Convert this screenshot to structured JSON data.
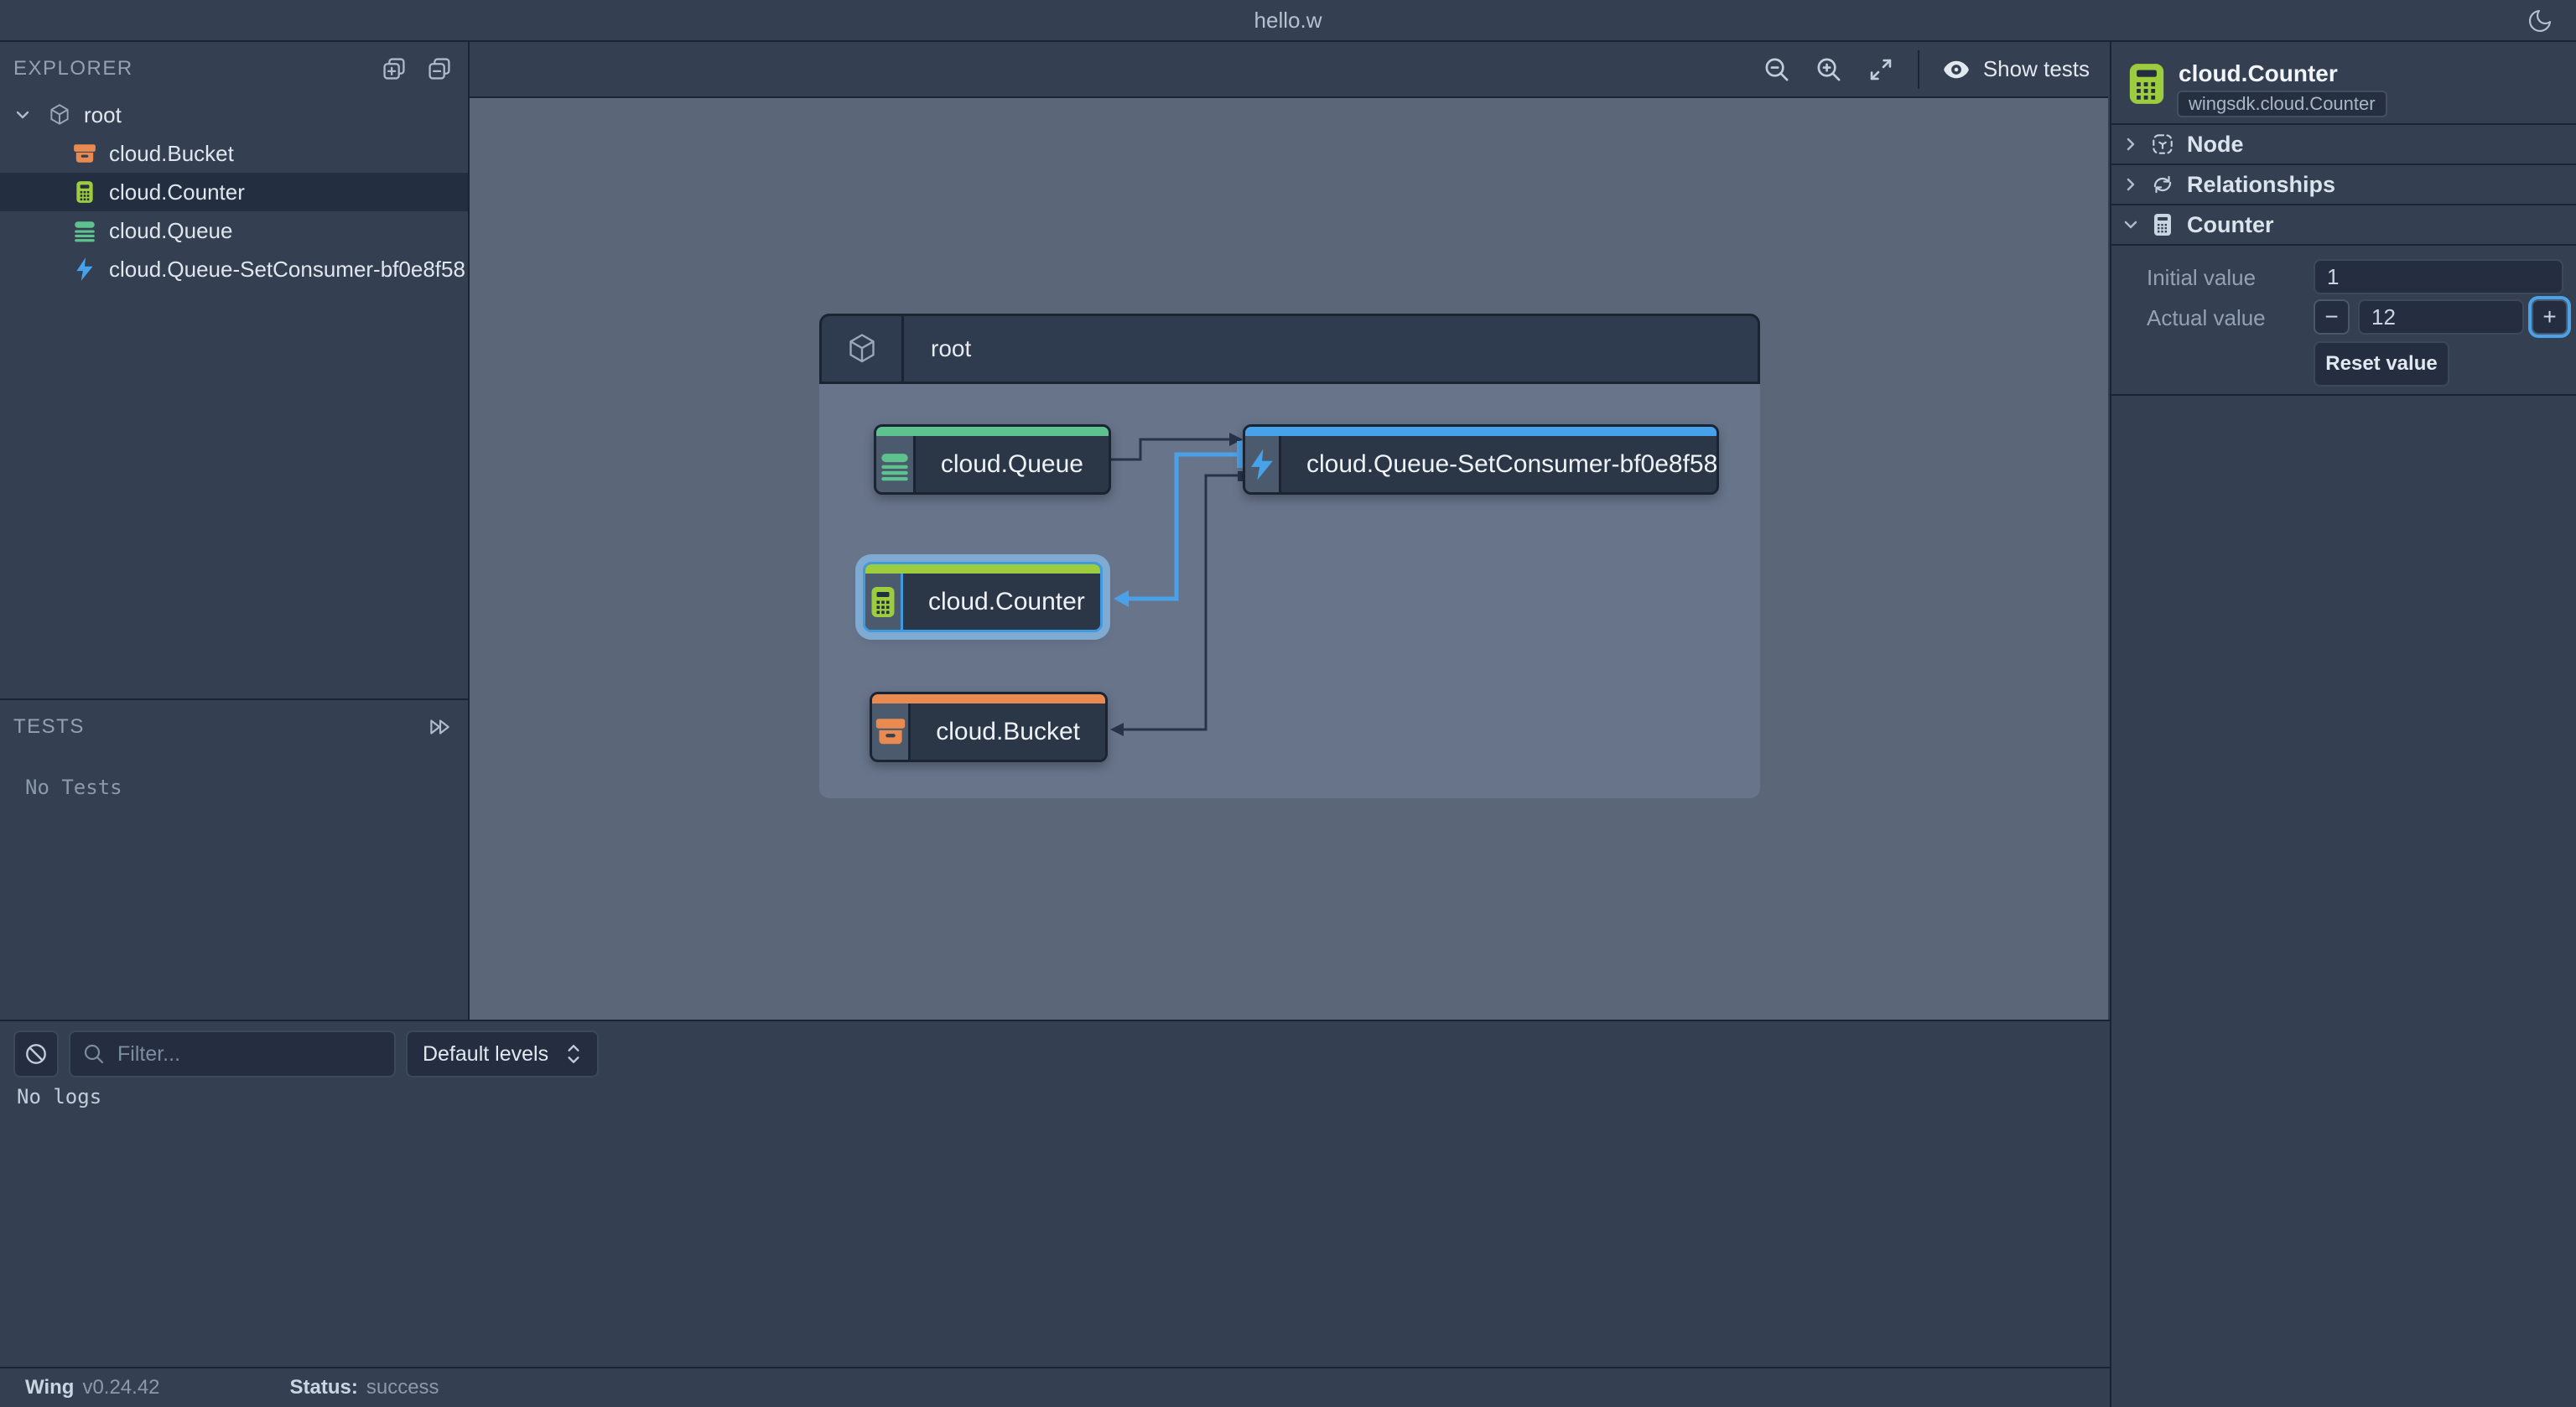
{
  "titlebar": {
    "title": "hello.w"
  },
  "explorer": {
    "title": "EXPLORER",
    "root": {
      "label": "root"
    },
    "items": [
      {
        "label": "cloud.Bucket",
        "icon": "bucket-icon",
        "color": "#e98a50",
        "selected": false
      },
      {
        "label": "cloud.Counter",
        "icon": "counter-icon",
        "color": "#9ecc3f",
        "selected": true
      },
      {
        "label": "cloud.Queue",
        "icon": "queue-icon",
        "color": "#5ec28f",
        "selected": false
      },
      {
        "label": "cloud.Queue-SetConsumer-bf0e8f58",
        "icon": "function-icon",
        "color": "#46a2e9",
        "selected": false
      }
    ]
  },
  "tests": {
    "title": "TESTS",
    "empty_message": "No Tests"
  },
  "canvas": {
    "toolbar": {
      "zoom_out_icon": "magnifier-minus",
      "zoom_in_icon": "magnifier-plus",
      "fit_icon": "arrows-expand",
      "show_tests_label": "Show tests"
    },
    "container": {
      "label": "root"
    },
    "nodes": [
      {
        "label": "cloud.Queue",
        "accent": "#5ec28f",
        "selected": false
      },
      {
        "label": "cloud.Queue-SetConsumer-bf0e8f58",
        "accent": "#46a2e9",
        "selected": false
      },
      {
        "label": "cloud.Counter",
        "accent": "#9ecc3f",
        "selected": true
      },
      {
        "label": "cloud.Bucket",
        "accent": "#e98a50",
        "selected": false
      }
    ],
    "edges": [
      {
        "from": "cloud.Queue",
        "to": "cloud.Queue-SetConsumer-bf0e8f58",
        "highlighted": false
      },
      {
        "from": "cloud.Queue-SetConsumer-bf0e8f58",
        "to": "cloud.Counter",
        "highlighted": true
      },
      {
        "from": "cloud.Queue-SetConsumer-bf0e8f58",
        "to": "cloud.Bucket",
        "highlighted": false
      }
    ]
  },
  "inspector": {
    "resource": {
      "name": "cloud.Counter",
      "type_badge": "wingsdk.cloud.Counter"
    },
    "sections": [
      {
        "label": "Node",
        "expanded": false
      },
      {
        "label": "Relationships",
        "expanded": false
      },
      {
        "label": "Counter",
        "expanded": true
      }
    ],
    "counter": {
      "initial_label": "Initial value",
      "initial_value": "1",
      "actual_label": "Actual value",
      "actual_value": "12",
      "decrement_label": "−",
      "increment_label": "+",
      "reset_label": "Reset value"
    }
  },
  "logs": {
    "filter_placeholder": "Filter...",
    "level_select": "Default levels",
    "empty_message": "No logs"
  },
  "statusbar": {
    "app": "Wing",
    "version": "v0.24.42",
    "status_label": "Status:",
    "status_value": "success"
  },
  "colors": {
    "base": "#343f51",
    "border": "#1a2433",
    "canvas": "#5b6679",
    "container": "#68748a",
    "node_dark": "#2b3747",
    "icon_cell": "#4c5a6d",
    "selected_row": "#232e41",
    "green": "#5ec28f",
    "lime": "#9ecc3f",
    "orange": "#e98a50",
    "blue": "#46a2e9",
    "edge_dark": "#28334a",
    "text": "#e8edf3",
    "text_dim": "#93a1b5"
  }
}
